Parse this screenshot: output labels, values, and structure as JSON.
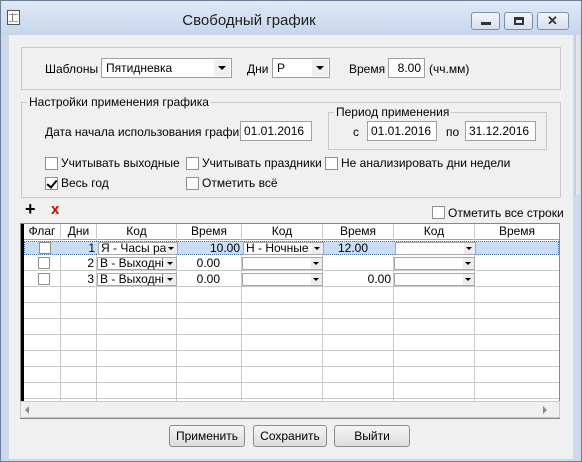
{
  "window": {
    "title": "Свободный график"
  },
  "top": {
    "templates_label": "Шаблоны",
    "templates_value": "Пятидневка",
    "days_label": "Дни",
    "days_value": "Р",
    "time_label": "Время",
    "time_value": "8.00",
    "time_unit": "(чч.мм)"
  },
  "settings": {
    "legend": "Настройки применения графика",
    "start_date_label": "Дата начала использования графика",
    "start_date_value": "01.01.2016",
    "period": {
      "legend": "Период применения",
      "from_label": "с",
      "from_value": "01.01.2016",
      "to_label": "по",
      "to_value": "31.12.2016"
    },
    "options": [
      {
        "label": "Учитывать выходные",
        "checked": false
      },
      {
        "label": "Учитывать праздники",
        "checked": false
      },
      {
        "label": "Не анализировать дни недели",
        "checked": false
      },
      {
        "label": "Весь год",
        "checked": true
      },
      {
        "label": "Отметить всё",
        "checked": false
      }
    ]
  },
  "toolbar": {
    "add_icon": "plus-icon",
    "delete_icon": "red-x-icon",
    "mark_all_label": "Отметить все строки"
  },
  "table": {
    "headers": [
      "Флаг",
      "Дни",
      "Код",
      "Время",
      "Код",
      "Время",
      "Код",
      "Время"
    ],
    "rows": [
      {
        "flag": false,
        "day": "1",
        "code1": "Я - Часы ра",
        "time1": "10.00",
        "code2": "Н - Ночные",
        "time2": "12.00",
        "code3": "",
        "time3": ""
      },
      {
        "flag": false,
        "day": "2",
        "code1": "В - Выходні",
        "time1": "0.00",
        "code2": "",
        "time2": "",
        "code3": "",
        "time3": ""
      },
      {
        "flag": false,
        "day": "3",
        "code1": "В - Выходні",
        "time1": "0.00",
        "code2": "",
        "time2": "0.00",
        "code3": "",
        "time3": ""
      }
    ],
    "selected_row": 0
  },
  "buttons": {
    "apply": "Применить",
    "save": "Сохранить",
    "exit": "Выйти"
  }
}
